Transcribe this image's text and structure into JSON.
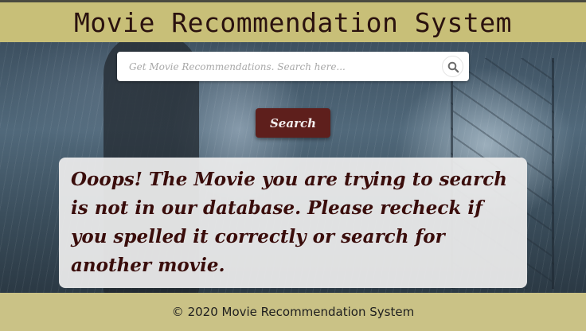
{
  "header": {
    "title": "Movie Recommendation System"
  },
  "search": {
    "placeholder": "Get Movie Recommendations. Search here...",
    "value": "",
    "icon": "search-icon",
    "button_label": "Search"
  },
  "message": {
    "text": "Ooops! The Movie you are trying to search is not in our database. Please recheck if you spelled it correctly or search for another movie."
  },
  "footer": {
    "text": "© 2020 Movie Recommendation System"
  },
  "colors": {
    "header_bg": "#c8bf78",
    "title_text": "#2a120f",
    "button_bg": "#5e1f1c",
    "message_text": "#3a0d0b",
    "footer_bg": "#cac286"
  }
}
